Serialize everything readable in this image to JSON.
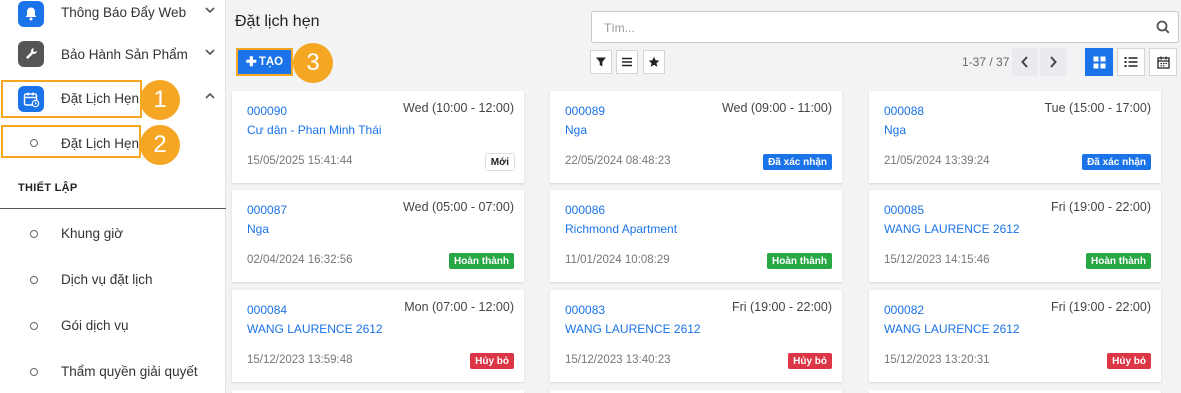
{
  "sidebar": {
    "items": [
      {
        "label": "Thông Báo Đẩy Web"
      },
      {
        "label": "Bảo Hành Sản Phẩm"
      },
      {
        "label": "Đặt Lịch Hẹn"
      }
    ],
    "active_sub": "Đặt Lịch Hẹn",
    "section_title": "THIẾT LẬP",
    "settings": [
      {
        "label": "Khung giờ"
      },
      {
        "label": "Dịch vụ đặt lịch"
      },
      {
        "label": "Gói dịch vụ"
      },
      {
        "label": "Thẩm quyền giải quyết"
      }
    ]
  },
  "annotations": [
    "1",
    "2",
    "3"
  ],
  "header": {
    "title": "Đặt lịch hẹn",
    "create_label": "TẠO",
    "search_placeholder": "Tìm...",
    "pager": "1-37 / 37"
  },
  "colors": {
    "primary": "#1a73e8",
    "highlight": "#f5a623",
    "new": "#ffffff",
    "confirmed": "#1a73e8",
    "done": "#28a745",
    "cancelled": "#dc3545"
  },
  "cards": [
    {
      "id": "000090",
      "time": "Wed (10:00 - 12:00)",
      "name": "Cư dân - Phan Minh Thái",
      "date": "15/05/2025 15:41:44",
      "status": "Mới",
      "status_type": "new"
    },
    {
      "id": "000089",
      "time": "Wed (09:00 - 11:00)",
      "name": "Nga",
      "date": "22/05/2024 08:48:23",
      "status": "Đã xác nhận",
      "status_type": "confirmed"
    },
    {
      "id": "000088",
      "time": "Tue (15:00 - 17:00)",
      "name": "Nga",
      "date": "21/05/2024 13:39:24",
      "status": "Đã xác nhận",
      "status_type": "confirmed"
    },
    {
      "id": "000087",
      "time": "Wed (05:00 - 07:00)",
      "name": "Nga",
      "date": "02/04/2024 16:32:56",
      "status": "Hoàn thành",
      "status_type": "done"
    },
    {
      "id": "000086",
      "time": "",
      "name": "Richmond Apartment",
      "date": "11/01/2024 10:08:29",
      "status": "Hoàn thành",
      "status_type": "done"
    },
    {
      "id": "000085",
      "time": "Fri (19:00 - 22:00)",
      "name": "WANG LAURENCE 2612",
      "date": "15/12/2023 14:15:46",
      "status": "Hoàn thành",
      "status_type": "done"
    },
    {
      "id": "000084",
      "time": "Mon (07:00 - 12:00)",
      "name": "WANG LAURENCE 2612",
      "date": "15/12/2023 13:59:48",
      "status": "Hủy bỏ",
      "status_type": "cancelled"
    },
    {
      "id": "000083",
      "time": "Fri (19:00 - 22:00)",
      "name": "WANG LAURENCE 2612",
      "date": "15/12/2023 13:40:23",
      "status": "Hủy bỏ",
      "status_type": "cancelled"
    },
    {
      "id": "000082",
      "time": "Fri (19:00 - 22:00)",
      "name": "WANG LAURENCE 2612",
      "date": "15/12/2023 13:20:31",
      "status": "Hủy bỏ",
      "status_type": "cancelled"
    }
  ]
}
